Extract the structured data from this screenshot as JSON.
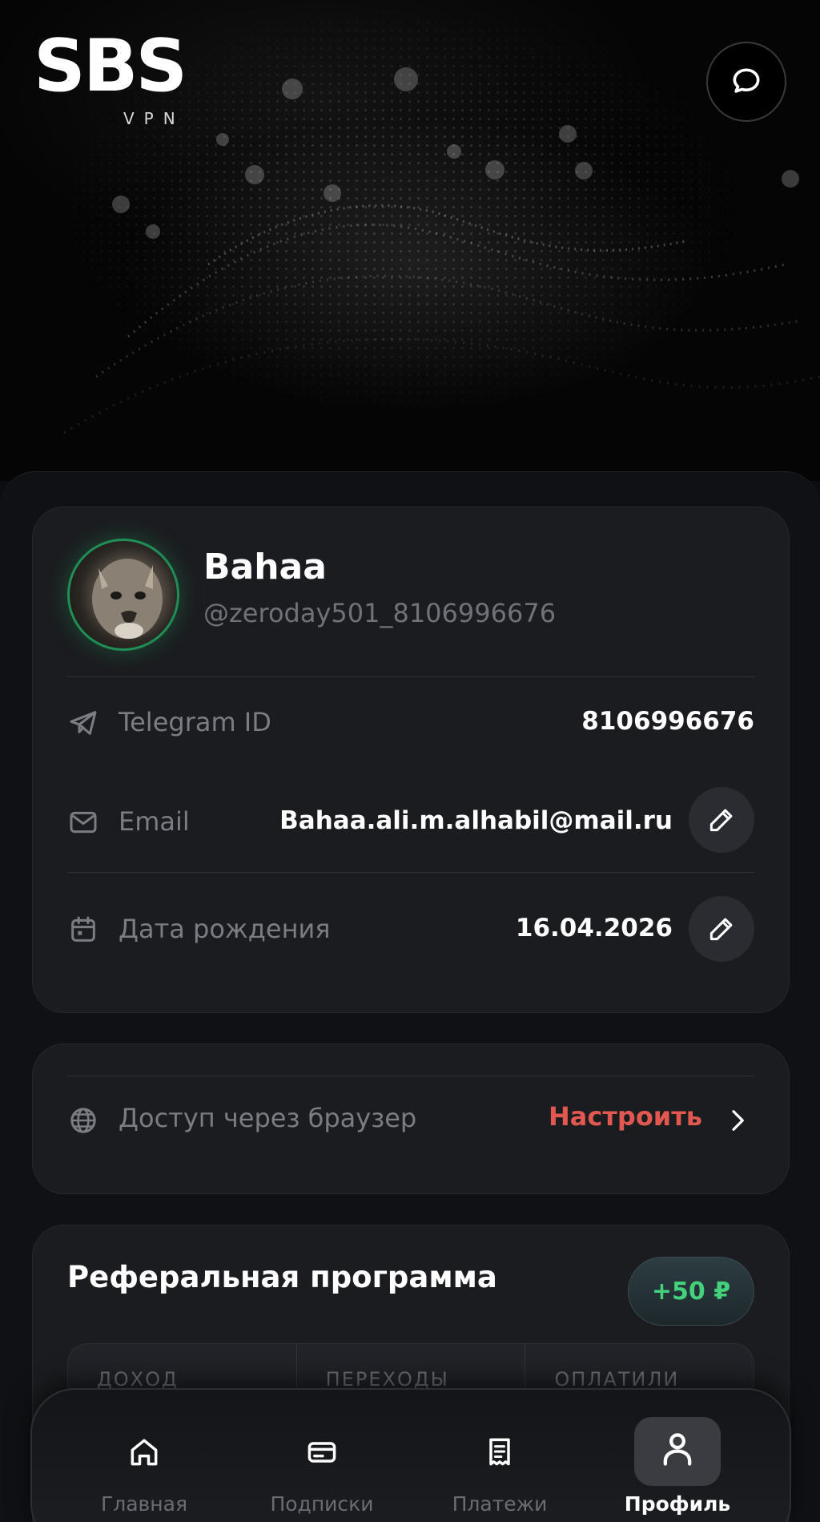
{
  "brand": {
    "name": "SBS",
    "sub": "VPN"
  },
  "profile": {
    "name": "Bahaa",
    "handle": "@zeroday501_8106996676",
    "telegram_label": "Telegram ID",
    "telegram_value": "8106996676",
    "email_label": "Email",
    "email_value": "Bahaa.ali.m.alhabil@mail.ru",
    "birth_label": "Дата рождения",
    "birth_value": "16.04.2026"
  },
  "browser_access": {
    "label": "Доступ через браузер",
    "action": "Настроить"
  },
  "referral": {
    "title": "Реферальная программа",
    "bonus": "+50 ₽",
    "stats": [
      "ДОХОД",
      "ПЕРЕХОДЫ",
      "ОПЛАТИЛИ"
    ]
  },
  "nav": {
    "items": [
      {
        "label": "Главная",
        "icon": "home-icon"
      },
      {
        "label": "Подписки",
        "icon": "card-icon"
      },
      {
        "label": "Платежи",
        "icon": "receipt-icon"
      },
      {
        "label": "Профиль",
        "icon": "user-icon",
        "active": true
      }
    ]
  },
  "colors": {
    "accent_red": "#e0584f",
    "accent_green": "#43d27b",
    "avatar_ring": "#1f8f56"
  }
}
